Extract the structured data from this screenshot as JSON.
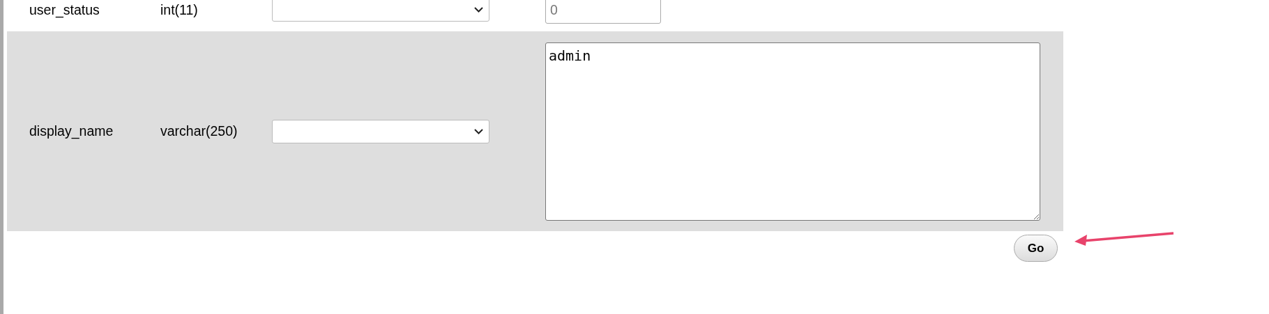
{
  "rows": [
    {
      "kind": "input",
      "name": "user_status",
      "type": "int(11)",
      "shaded": false,
      "placeholder": "0"
    },
    {
      "kind": "textarea",
      "name": "display_name",
      "type": "varchar(250)",
      "shaded": true,
      "value": "admin"
    }
  ],
  "submit_button": "Go"
}
